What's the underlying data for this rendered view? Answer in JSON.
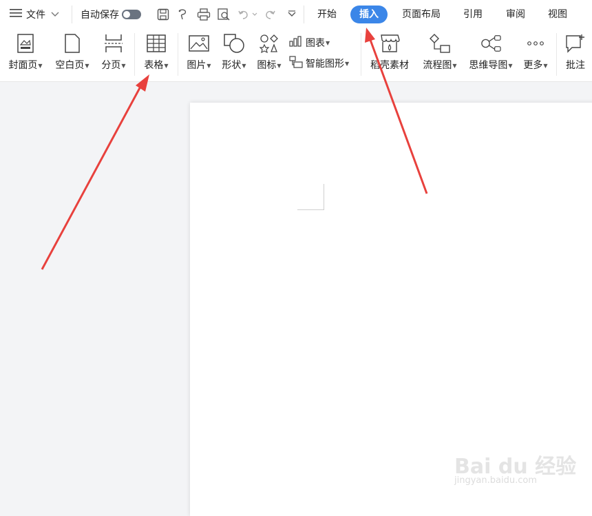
{
  "topbar": {
    "file_menu": "文件",
    "autosave_label": "自动保存",
    "tabs": [
      {
        "label": "开始"
      },
      {
        "label": "插入",
        "active": true
      },
      {
        "label": "页面布局"
      },
      {
        "label": "引用"
      },
      {
        "label": "审阅"
      },
      {
        "label": "视图"
      }
    ],
    "active_color": "#3b86e8"
  },
  "ribbon": {
    "cover_page": "封面页",
    "blank_page": "空白页",
    "page_break": "分页",
    "table": "表格",
    "picture": "图片",
    "shape": "形状",
    "icon": "图标",
    "chart": "图表",
    "smart_art": "智能图形",
    "material": "稻壳素材",
    "flowchart": "流程图",
    "mindmap": "思维导图",
    "more": "更多",
    "comment": "批注"
  },
  "watermark": {
    "brand": "Bai du 经验",
    "url": "jingyan.baidu.com"
  },
  "annotation_color": "#e8413d"
}
